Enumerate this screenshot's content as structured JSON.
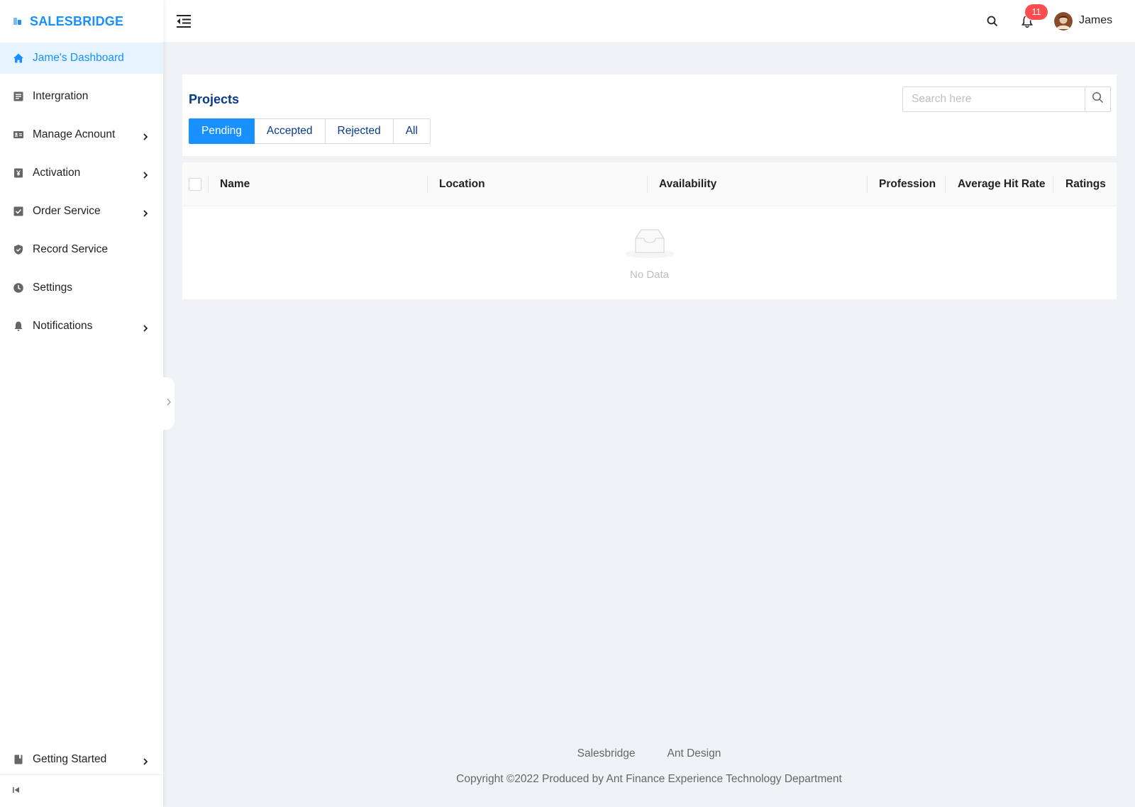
{
  "app": {
    "name": "SALESBRIDGE"
  },
  "sidebar": {
    "items": [
      {
        "label": "Jame's Dashboard",
        "icon": "home-icon",
        "active": true,
        "has_children": false
      },
      {
        "label": "Intergration",
        "icon": "file-text-icon",
        "active": false,
        "has_children": false
      },
      {
        "label": "Manage Acnount",
        "icon": "id-card-icon",
        "active": false,
        "has_children": true
      },
      {
        "label": "Activation",
        "icon": "money-collect-icon",
        "active": false,
        "has_children": true
      },
      {
        "label": "Order Service",
        "icon": "check-square-icon",
        "active": false,
        "has_children": true
      },
      {
        "label": "Record Service",
        "icon": "safety-icon",
        "active": false,
        "has_children": false
      },
      {
        "label": "Settings",
        "icon": "clock-icon",
        "active": false,
        "has_children": false
      },
      {
        "label": "Notifications",
        "icon": "bell-icon",
        "active": false,
        "has_children": true
      }
    ],
    "bottom_item": {
      "label": "Getting Started",
      "icon": "book-icon",
      "has_children": true
    }
  },
  "header": {
    "notification_count": "11",
    "user_name": "James"
  },
  "projects": {
    "title": "Projects",
    "search_placeholder": "Search here",
    "tabs": [
      {
        "label": "Pending",
        "active": true
      },
      {
        "label": "Accepted",
        "active": false
      },
      {
        "label": "Rejected",
        "active": false
      },
      {
        "label": "All",
        "active": false
      }
    ]
  },
  "table": {
    "columns": [
      "Name",
      "Location",
      "Availability",
      "Profession",
      "Average Hit Rate",
      "Ratings"
    ],
    "rows": [],
    "empty_text": "No Data"
  },
  "footer": {
    "links": [
      "Salesbridge",
      "Ant Design"
    ],
    "copyright": "Copyright ©2022 Produced by Ant Finance Experience Technology Department"
  },
  "colors": {
    "primary": "#1890ff",
    "title": "#0a3a8c",
    "badge": "#ff4d4f",
    "background": "#f0f2f5"
  }
}
